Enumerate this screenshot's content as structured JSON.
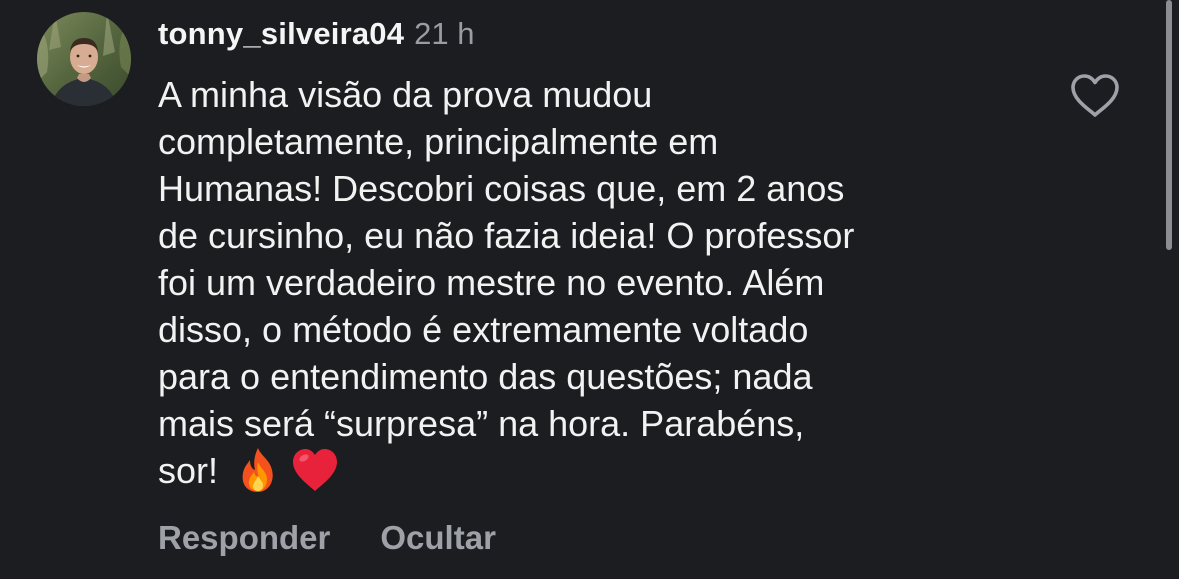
{
  "comment": {
    "username": "tonny_silveira04",
    "time": "21 h",
    "text_lines": [
      "A minha visão da prova mudou",
      "completamente, principalmente em",
      "Humanas! Descobri coisas que, em 2 anos",
      "de cursinho, eu não fazia ideia! O professor",
      "foi um verdadeiro mestre no evento. Além",
      "disso, o método é extremamente voltado",
      "para o entendimento das questões; nada",
      "mais será “surpresa” na hora. Parabéns,",
      "sor!"
    ],
    "emojis": [
      "fire-emoji",
      "red-heart-emoji"
    ],
    "like_icon": "heart-outline-icon"
  },
  "actions": {
    "reply_label": "Responder",
    "hide_label": "Ocultar"
  },
  "colors": {
    "background": "#1c1d20",
    "text": "#f2f2f2",
    "secondary_text": "#9ea1a8",
    "heart_red": "#e8223a"
  }
}
